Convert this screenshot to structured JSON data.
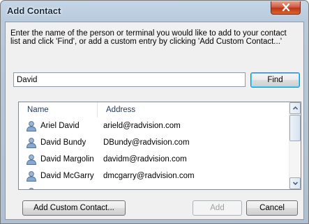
{
  "window": {
    "title": "Add Contact",
    "close_icon": "close-icon"
  },
  "instructions": {
    "line1": "Enter the name of the person or terminal you would like to add to your contact",
    "line2": "list and click 'Find', or add a custom entry by clicking 'Add Custom Contact...'"
  },
  "search": {
    "value": "David",
    "find_label": "Find"
  },
  "contacts": {
    "columns": [
      "Name",
      "Address"
    ],
    "row_icon": "person-icon",
    "rows": [
      {
        "name": "Ariel David",
        "address": "arield@radvision.com"
      },
      {
        "name": "David Bundy",
        "address": "DBundy@radvision.com"
      },
      {
        "name": "David Margolin",
        "address": "davidm@radvision.com"
      },
      {
        "name": "David McGarry",
        "address": "dmcgarry@radvision.com"
      }
    ]
  },
  "buttons": {
    "add_custom_label": "Add Custom Contact...",
    "add_label": "Add",
    "add_enabled": false,
    "cancel_label": "Cancel"
  },
  "colors": {
    "title_bar": "#b9cadc",
    "close_button": "#c9462a",
    "find_focus_border": "#3c7fb1",
    "header_text": "#1e395b"
  }
}
